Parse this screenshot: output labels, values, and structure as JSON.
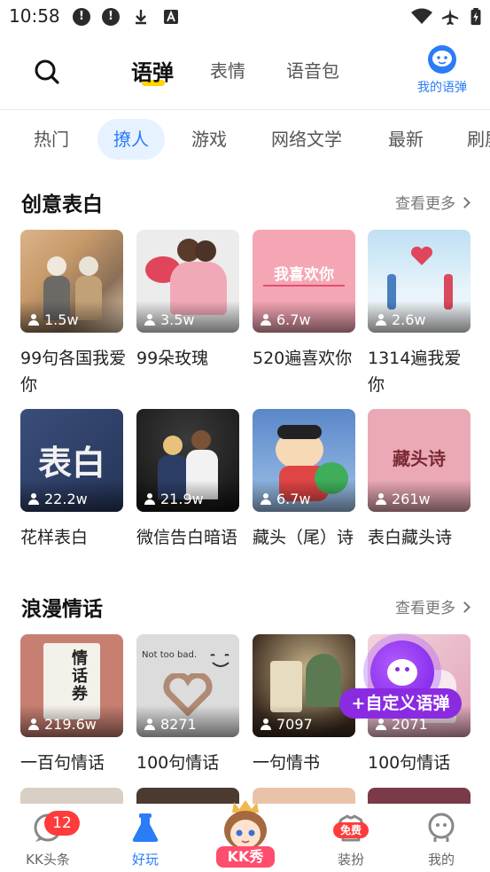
{
  "status_bar": {
    "time": "10:58"
  },
  "header": {
    "tabs": [
      {
        "label": "语弹"
      },
      {
        "label": "表情"
      },
      {
        "label": "语音包"
      }
    ],
    "my_danmu_label": "我的语弹"
  },
  "categories": [
    "热门",
    "撩人",
    "游戏",
    "网络文学",
    "最新",
    "刷屏"
  ],
  "sections": [
    {
      "title": "创意表白",
      "more": "查看更多",
      "cards": [
        {
          "count": "1.5w",
          "title": "99句各国我爱你"
        },
        {
          "count": "3.5w",
          "title": "99朵玫瑰"
        },
        {
          "count": "6.7w",
          "title": "520遍喜欢你",
          "thumb_text": "我喜欢你"
        },
        {
          "count": "2.6w",
          "title": "1314遍我爱你"
        },
        {
          "count": "22.2w",
          "title": "花样表白",
          "thumb_text": "表白"
        },
        {
          "count": "21.9w",
          "title": "微信告白暗语"
        },
        {
          "count": "6.7w",
          "title": "藏头（尾）诗"
        },
        {
          "count": "261w",
          "title": "表白藏头诗",
          "thumb_text": "藏头诗"
        }
      ]
    },
    {
      "title": "浪漫情话",
      "more": "查看更多",
      "cards": [
        {
          "count": "219.6w",
          "title": "一百句情话",
          "thumb_text": "情话券"
        },
        {
          "count": "8271",
          "title": "100句情话",
          "thumb_text": "Not too bad."
        },
        {
          "count": "7097",
          "title": "一句情书"
        },
        {
          "count": "2071",
          "title": "100句情话"
        }
      ]
    }
  ],
  "fab": {
    "label": "+自定义语弹"
  },
  "bottom_nav": {
    "items": [
      {
        "label": "KK头条",
        "badge": "12"
      },
      {
        "label": "好玩"
      },
      {
        "label": "KK秀"
      },
      {
        "label": "装扮",
        "badge": "免费"
      },
      {
        "label": "我的"
      }
    ]
  },
  "colors": {
    "accent": "#2a7cf7",
    "highlight": "#ffd400",
    "fab": "#8a2be2",
    "badge": "#ff3b3b"
  }
}
